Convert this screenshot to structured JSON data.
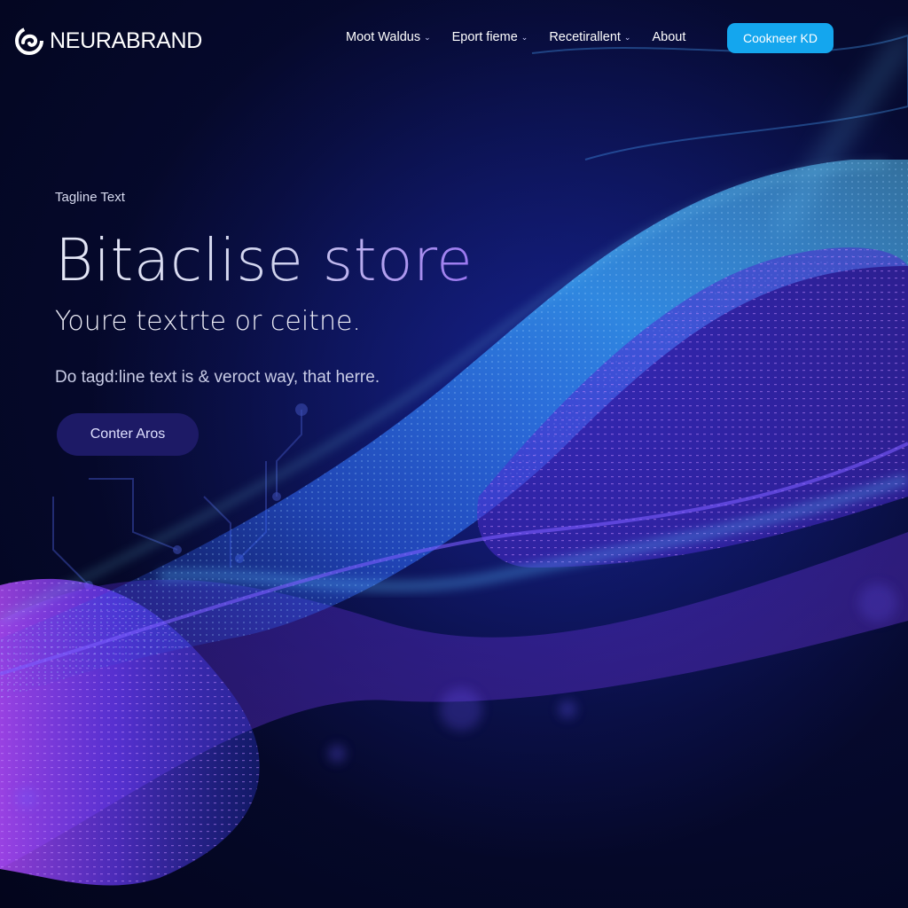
{
  "brand": {
    "name": "NEURABRAND"
  },
  "nav": {
    "items": [
      {
        "label": "Moot Waldus",
        "has_dropdown": true
      },
      {
        "label": "Eport fieme",
        "has_dropdown": true
      },
      {
        "label": "Recetirallent",
        "has_dropdown": true
      },
      {
        "label": "About",
        "has_dropdown": false
      }
    ],
    "cta_label": "Cookneer KD"
  },
  "hero": {
    "tagline": "Tagline Text",
    "headline": "Bitaclise store",
    "subheadline": "Youre textrte or ceitne.",
    "body": "Do tagd:line text is & veroct way, that herre.",
    "cta_label": "Conter Aros"
  },
  "colors": {
    "background": "#060a30",
    "accent_blue": "#14a6ee",
    "accent_purple": "#8a5cf0",
    "hero_button": "#1d1a66"
  },
  "icons": {
    "logo": "brand-logo-icon",
    "dropdown": "chevron-down-icon"
  }
}
